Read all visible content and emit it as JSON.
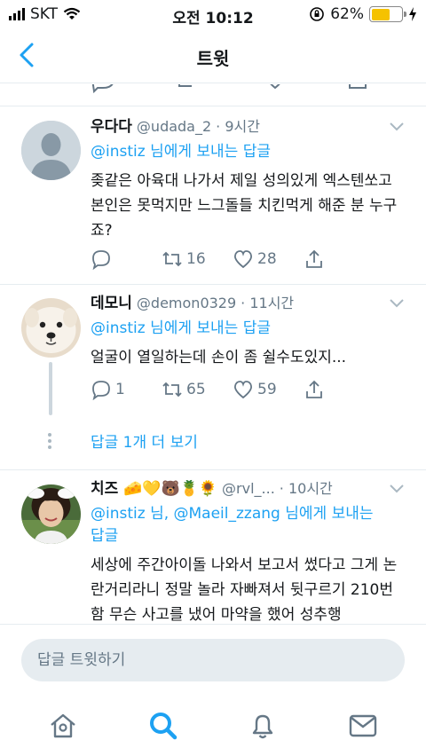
{
  "status_bar": {
    "carrier": "SKT",
    "time": "오전 10:12",
    "battery_percent": "62%",
    "battery_level": 0.62,
    "battery_color": "#f5c200"
  },
  "header": {
    "title": "트윗",
    "back_icon": "chevron-left-icon"
  },
  "colors": {
    "accent": "#1da1f2",
    "muted": "#657786",
    "divider": "#e6ecf0"
  },
  "tweets": [
    {
      "name": "우다다",
      "handle": "@udada_2",
      "time": "· 9시간",
      "reply_prefix_mention": "@instiz",
      "reply_suffix": "님에게 보내는 답글",
      "text": "좆같은 아육대 나가서 제일 성의있게 엑스텐쏘고 본인은 못먹지만 느그돌들 치킨먹게 해준 분 누구죠?",
      "reply_count": "",
      "retweet_count": "16",
      "like_count": "28"
    },
    {
      "name": "데모니",
      "handle": "@demon0329",
      "time": "· 11시간",
      "reply_prefix_mention": "@instiz",
      "reply_suffix": "님에게 보내는 답글",
      "text": "얼굴이 열일하는데 손이 좀 쉴수도있지...",
      "reply_count": "1",
      "retweet_count": "65",
      "like_count": "59",
      "more_replies": "답글 1개 더 보기"
    },
    {
      "name": "치즈 🧀💛🐻🍍🌻",
      "handle": "@rvl_...",
      "time": "· 10시간",
      "reply_mentions": "@instiz 님, @Maeil_zzang",
      "reply_suffix": "님에게 보내는",
      "reply_suffix2": "답글",
      "text": "세상에 주간아이돌 나와서 보고서 썼다고 그게 논란거리라니 정말 놀라 자빠져서 뒷구르기 210번함 무슨 사고를 냈어 마약을 했어 성추행"
    }
  ],
  "reply_bar": {
    "placeholder": "답글 트윗하기"
  },
  "tabbar": {
    "items": [
      "home-icon",
      "search-icon",
      "notifications-icon",
      "messages-icon"
    ]
  }
}
